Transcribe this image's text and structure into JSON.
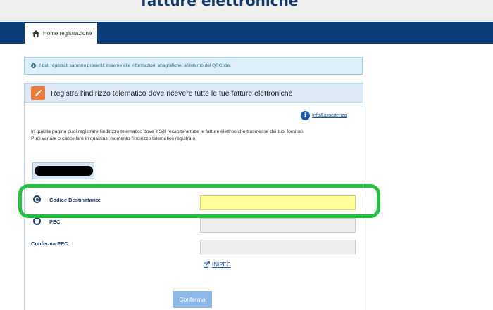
{
  "header": {
    "site_title": "fatture elettroniche"
  },
  "nav": {
    "home_tab_label": "Home registrazione",
    "home_icon": "home-icon"
  },
  "alert": {
    "text": "I dati registrati saranno presenti, insieme alle informazioni anagrafiche, all'interno del QRCode.",
    "icon": "info-icon"
  },
  "panel": {
    "title": "Registra l'indirizzo telematico dove ricevere tutte le tue fatture elettroniche",
    "title_icon": "pencil-icon",
    "help_link": "Info&assistenza",
    "description_line1": "In questa pagina puoi registrare l'indirizzo telematico dove il SdI recapiterà tutte le fatture elettroniche trasmesse dai tuoi fornitori.",
    "description_line2": "Puoi variare o cancellare in qualsiasi momento l'indirizzo telematico registrato."
  },
  "form": {
    "codice_destinatario_label": "Codice Destinatario:",
    "codice_destinatario_value": "",
    "codice_destinatario_selected": true,
    "pec_label": "PEC:",
    "pec_value": "",
    "conferma_pec_label": "Conferma PEC:",
    "conferma_pec_value": "",
    "inipec_link": "INIPEC",
    "confirm_button": "Conferma"
  },
  "colors": {
    "nav_bar": "#0b3c7b",
    "accent_orange": "#ee7b36",
    "active_field": "#ffff9c",
    "highlight_green": "#21c33e",
    "button": "#8db8e8"
  }
}
